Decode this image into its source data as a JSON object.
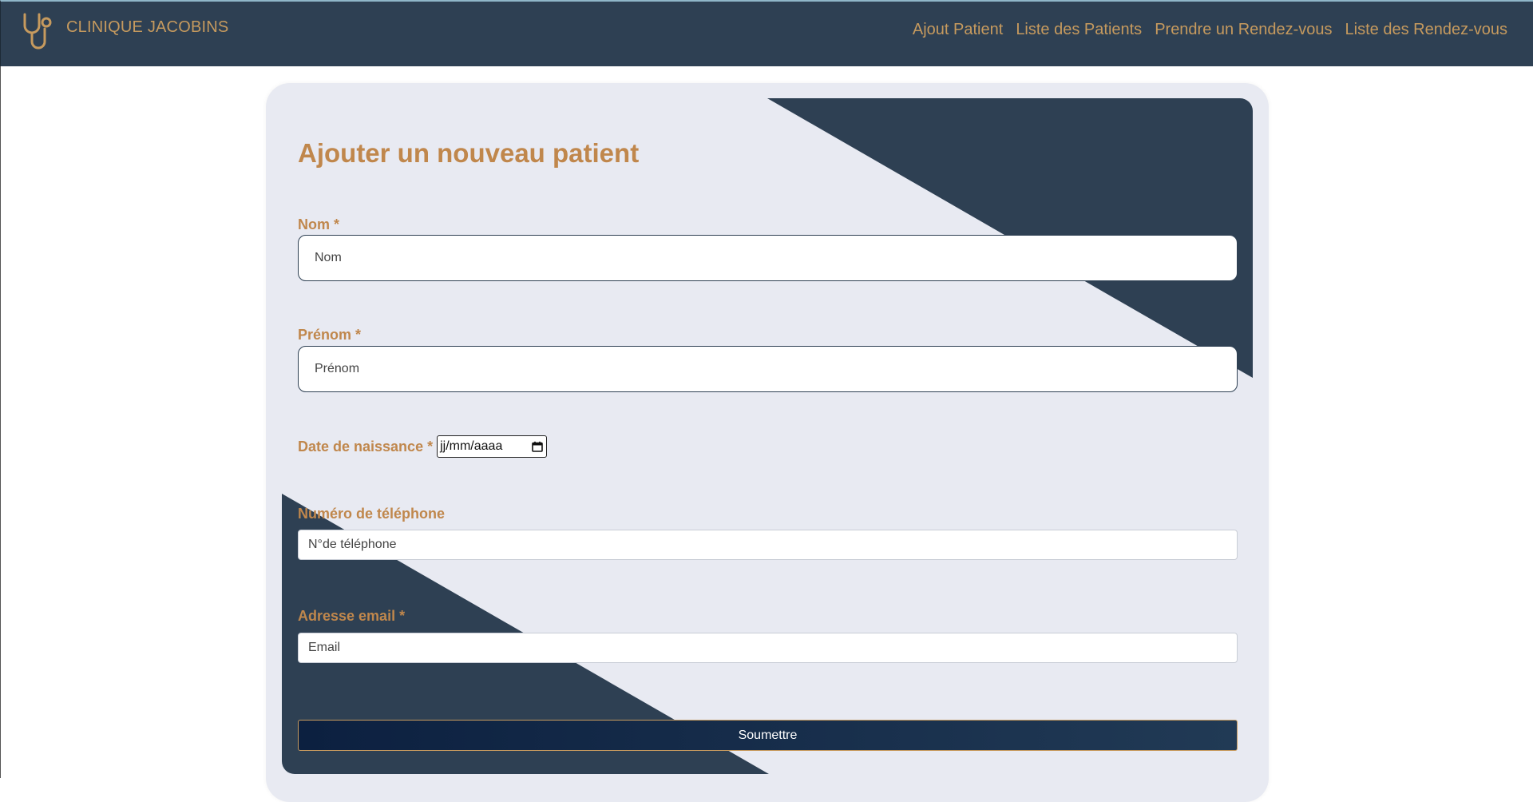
{
  "brand": {
    "name": "CLINIQUE JACOBINS",
    "icon": "stethoscope-icon",
    "color": "#c69a5e"
  },
  "nav": {
    "items": [
      {
        "label": "Ajout Patient"
      },
      {
        "label": "Liste des Patients"
      },
      {
        "label": "Prendre un Rendez-vous"
      },
      {
        "label": "Liste des Rendez-vous"
      }
    ],
    "background": "#2e4053"
  },
  "form": {
    "title": "Ajouter un nouveau patient",
    "nom": {
      "label": "Nom *",
      "placeholder": "Nom",
      "value": ""
    },
    "prenom": {
      "label": "Prénom *",
      "placeholder": "Prénom",
      "value": ""
    },
    "dob": {
      "label": "Date de naissance *",
      "format": "jj/mm/aaaa",
      "icon": "calendar-icon"
    },
    "telephone": {
      "label": "Numéro de téléphone",
      "placeholder": "N°de téléphone",
      "value": ""
    },
    "email": {
      "label": "Adresse email *",
      "placeholder": "Email",
      "value": ""
    },
    "submit_label": "Soumettre"
  },
  "colors": {
    "accent": "#c0874c",
    "panel": "#e8eaf2",
    "dark": "#2e4053"
  }
}
